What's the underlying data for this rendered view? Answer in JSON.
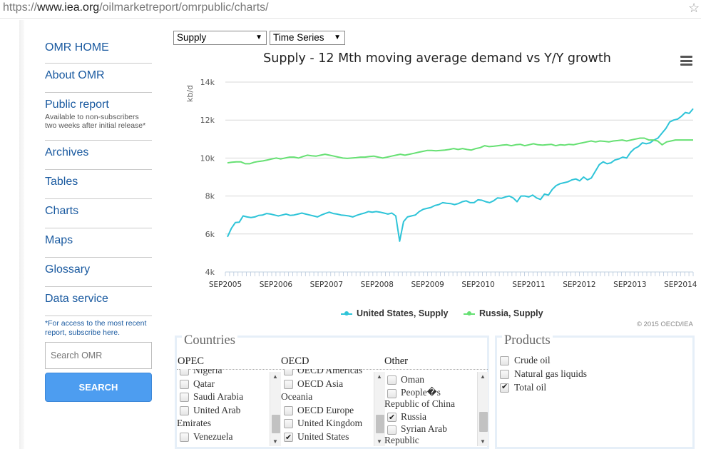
{
  "browser": {
    "url_scheme": "https://",
    "url_host": "www.iea.org",
    "url_path": "/oilmarketreport/omrpublic/charts/"
  },
  "sidebar": {
    "items": [
      {
        "label": "OMR HOME"
      },
      {
        "label": "About OMR"
      },
      {
        "label": "Public report",
        "sub": "Available to non-subscribers two weeks after initial release*"
      },
      {
        "label": "Archives"
      },
      {
        "label": "Tables"
      },
      {
        "label": "Charts"
      },
      {
        "label": "Maps"
      },
      {
        "label": "Glossary"
      },
      {
        "label": "Data service"
      }
    ],
    "access_note": "*For access to the most recent report, subscribe here.",
    "search_placeholder": "Search OMR",
    "search_button": "SEARCH"
  },
  "controls": {
    "series_select": "Supply",
    "mode_select": "Time Series"
  },
  "chart_data": {
    "type": "line",
    "title": "Supply - 12 Mth moving average demand vs Y/Y growth",
    "ylabel": "kb/d",
    "xlabel": "",
    "ylim": [
      4000,
      14000
    ],
    "yticks": [
      "4k",
      "6k",
      "8k",
      "10k",
      "12k",
      "14k"
    ],
    "yticks_values": [
      4000,
      6000,
      8000,
      10000,
      12000,
      14000
    ],
    "xticks": [
      "SEP2005",
      "SEP2006",
      "SEP2007",
      "SEP2008",
      "SEP2009",
      "SEP2010",
      "SEP2011",
      "SEP2012",
      "SEP2013",
      "SEP2014"
    ],
    "x_start": "2005-09",
    "x_end": "2014-12",
    "grid": true,
    "legend_position": "bottom",
    "series": [
      {
        "name": "United States, Supply",
        "color": "#2ec4d8",
        "values": [
          5850,
          6300,
          6600,
          6620,
          6950,
          6900,
          6870,
          6900,
          6980,
          7000,
          7080,
          7050,
          7000,
          6950,
          7000,
          7050,
          6980,
          7000,
          7050,
          7100,
          7050,
          7000,
          6950,
          6900,
          7000,
          7080,
          7150,
          7080,
          7050,
          7000,
          6980,
          6950,
          6900,
          6980,
          7050,
          7100,
          7180,
          7150,
          7180,
          7150,
          7100,
          7050,
          7100,
          6950,
          5620,
          6650,
          6900,
          6950,
          7000,
          7180,
          7300,
          7350,
          7400,
          7500,
          7550,
          7650,
          7620,
          7600,
          7550,
          7600,
          7700,
          7750,
          7650,
          7650,
          7800,
          7780,
          7700,
          7650,
          7750,
          7900,
          7880,
          7950,
          8000,
          7900,
          7700,
          8000,
          8000,
          7950,
          8050,
          7900,
          7820,
          8100,
          8050,
          8350,
          8550,
          8650,
          8700,
          8750,
          8850,
          8900,
          8800,
          9000,
          8850,
          8950,
          9300,
          9650,
          9800,
          9700,
          9750,
          9900,
          9950,
          10050,
          10000,
          10300,
          10500,
          10600,
          10800,
          10750,
          10800,
          10950,
          11050,
          11300,
          11550,
          11900,
          12000,
          12050,
          12200,
          12400,
          12350,
          12600
        ]
      },
      {
        "name": "Russia, Supply",
        "color": "#66e073",
        "values": [
          9750,
          9780,
          9800,
          9800,
          9700,
          9700,
          9780,
          9820,
          9850,
          9900,
          9950,
          10000,
          9950,
          10000,
          10050,
          10050,
          10000,
          10080,
          10150,
          10120,
          10100,
          10150,
          10200,
          10150,
          10100,
          10050,
          10000,
          9980,
          10000,
          10020,
          10050,
          10050,
          10080,
          10100,
          10050,
          10000,
          10050,
          10100,
          10150,
          10200,
          10150,
          10200,
          10250,
          10300,
          10350,
          10400,
          10400,
          10380,
          10400,
          10420,
          10450,
          10500,
          10450,
          10500,
          10450,
          10420,
          10500,
          10550,
          10650,
          10600,
          10620,
          10650,
          10680,
          10700,
          10650,
          10700,
          10720,
          10650,
          10700,
          10750,
          10700,
          10680,
          10700,
          10720,
          10650,
          10700,
          10680,
          10720,
          10700,
          10750,
          10800,
          10850,
          10900,
          10850,
          10900,
          10880,
          10850,
          10900,
          10920,
          10950,
          10900,
          10950,
          11000,
          11050,
          11050,
          10950,
          10950,
          10900,
          10700,
          10850,
          10900,
          10950,
          10950,
          10950,
          10950,
          10950
        ]
      }
    ]
  },
  "credits": "© 2015 OECD/IEA",
  "countries": {
    "title": "Countries",
    "opec": {
      "header": "OPEC",
      "items": [
        {
          "label": "Nigeria",
          "checked": false
        },
        {
          "label": "Qatar",
          "checked": false
        },
        {
          "label": "Saudi Arabia",
          "checked": false
        },
        {
          "label": "United Arab Emirates",
          "checked": false
        },
        {
          "label": "Venezuela",
          "checked": false
        }
      ]
    },
    "oecd": {
      "header": "OECD",
      "items": [
        {
          "label": "OECD Americas",
          "checked": false
        },
        {
          "label": "OECD Asia Oceania",
          "checked": false
        },
        {
          "label": "OECD Europe",
          "checked": false
        },
        {
          "label": "United Kingdom",
          "checked": false
        },
        {
          "label": "United States",
          "checked": true
        }
      ]
    },
    "other": {
      "header": "Other",
      "items": [
        {
          "label": "Oman",
          "checked": false
        },
        {
          "label": "People�s Republic of China",
          "checked": false
        },
        {
          "label": "Russia",
          "checked": true
        },
        {
          "label": "Syrian Arab Republic",
          "checked": false
        }
      ]
    }
  },
  "products": {
    "title": "Products",
    "items": [
      {
        "label": "Crude oil",
        "checked": false
      },
      {
        "label": "Natural gas liquids",
        "checked": false
      },
      {
        "label": "Total oil",
        "checked": true
      }
    ]
  }
}
